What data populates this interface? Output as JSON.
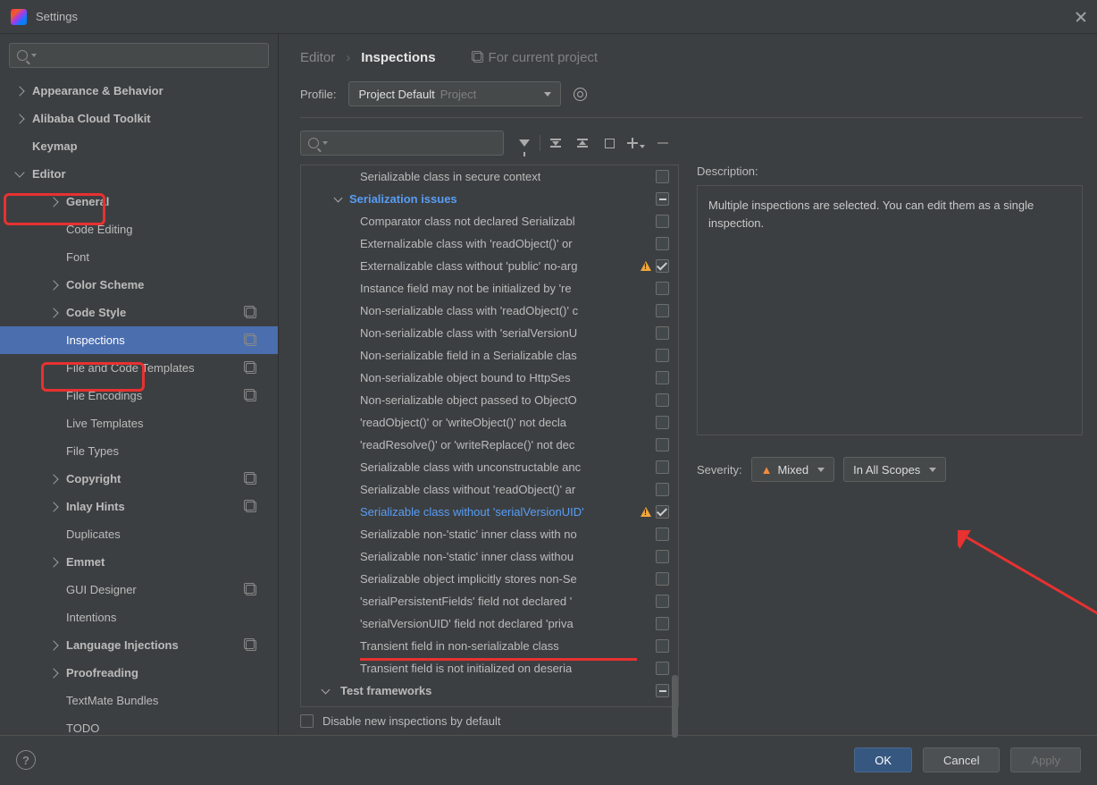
{
  "window": {
    "title": "Settings"
  },
  "sidebar": {
    "items": [
      {
        "label": "Appearance & Behavior",
        "bold": true,
        "chevron": true
      },
      {
        "label": "Alibaba Cloud Toolkit",
        "bold": true,
        "chevron": true
      },
      {
        "label": "Keymap",
        "bold": true,
        "chevron": false
      },
      {
        "label": "Editor",
        "bold": true,
        "chevron": true,
        "expanded": true
      },
      {
        "label": "General",
        "sub": true,
        "chevron": true
      },
      {
        "label": "Code Editing",
        "child": true
      },
      {
        "label": "Font",
        "child": true
      },
      {
        "label": "Color Scheme",
        "sub": true,
        "chevron": true
      },
      {
        "label": "Code Style",
        "sub": true,
        "chevron": true,
        "copy": true
      },
      {
        "label": "Inspections",
        "child": true,
        "selected": true,
        "copy": true
      },
      {
        "label": "File and Code Templates",
        "child": true,
        "copy": true
      },
      {
        "label": "File Encodings",
        "child": true,
        "copy": true
      },
      {
        "label": "Live Templates",
        "child": true
      },
      {
        "label": "File Types",
        "child": true
      },
      {
        "label": "Copyright",
        "sub": true,
        "chevron": true,
        "copy": true
      },
      {
        "label": "Inlay Hints",
        "sub": true,
        "chevron": true,
        "copy": true
      },
      {
        "label": "Duplicates",
        "child": true
      },
      {
        "label": "Emmet",
        "sub": true,
        "chevron": true
      },
      {
        "label": "GUI Designer",
        "child": true,
        "copy": true
      },
      {
        "label": "Intentions",
        "child": true
      },
      {
        "label": "Language Injections",
        "sub": true,
        "chevron": true,
        "copy": true
      },
      {
        "label": "Proofreading",
        "sub": true,
        "chevron": true
      },
      {
        "label": "TextMate Bundles",
        "child": true
      },
      {
        "label": "TODO",
        "child": true
      }
    ]
  },
  "breadcrumb": {
    "c0": "Editor",
    "c1": "Inspections",
    "proj": "For current project"
  },
  "profile": {
    "label": "Profile:",
    "name": "Project Default",
    "tag": "Project"
  },
  "inspections": [
    {
      "label": "Serializable class in secure context",
      "checked": false
    },
    {
      "label": "Serialization issues",
      "group": true,
      "mixed": true
    },
    {
      "label": "Comparator class not declared Serializabl",
      "checked": false
    },
    {
      "label": "Externalizable class with 'readObject()' or",
      "checked": false
    },
    {
      "label": "Externalizable class without 'public' no-arg",
      "checked": true,
      "warn": true
    },
    {
      "label": "Instance field may not be initialized by 're",
      "checked": false
    },
    {
      "label": "Non-serializable class with 'readObject()' c",
      "checked": false
    },
    {
      "label": "Non-serializable class with 'serialVersionU",
      "checked": false
    },
    {
      "label": "Non-serializable field in a Serializable clas",
      "checked": false
    },
    {
      "label": "Non-serializable object bound to HttpSes",
      "checked": false
    },
    {
      "label": "Non-serializable object passed to ObjectO",
      "checked": false
    },
    {
      "label": "'readObject()' or 'writeObject()' not decla",
      "checked": false
    },
    {
      "label": "'readResolve()' or 'writeReplace()' not dec",
      "checked": false
    },
    {
      "label": "Serializable class with unconstructable anc",
      "checked": false
    },
    {
      "label": "Serializable class without 'readObject()' ar",
      "checked": false
    },
    {
      "label": "Serializable class without 'serialVersionUID'",
      "checked": true,
      "hl": true,
      "warn": true
    },
    {
      "label": "Serializable non-'static' inner class with no",
      "checked": false
    },
    {
      "label": "Serializable non-'static' inner class withou",
      "checked": false
    },
    {
      "label": "Serializable object implicitly stores non-Se",
      "checked": false
    },
    {
      "label": "'serialPersistentFields' field not declared '",
      "checked": false
    },
    {
      "label": "'serialVersionUID' field not declared 'priva",
      "checked": false
    },
    {
      "label": "Transient field in non-serializable class",
      "checked": false
    },
    {
      "label": "Transient field is not initialized on deseria",
      "checked": false
    },
    {
      "label": "Test frameworks",
      "group": true,
      "mixed": true,
      "bottom": true
    }
  ],
  "description": {
    "label": "Description:",
    "text": "Multiple inspections are selected. You can edit them as a single inspection."
  },
  "severity": {
    "label": "Severity:",
    "value": "Mixed",
    "scope": "In All Scopes"
  },
  "disable_label": "Disable new inspections by default",
  "buttons": {
    "ok": "OK",
    "cancel": "Cancel",
    "apply": "Apply"
  }
}
